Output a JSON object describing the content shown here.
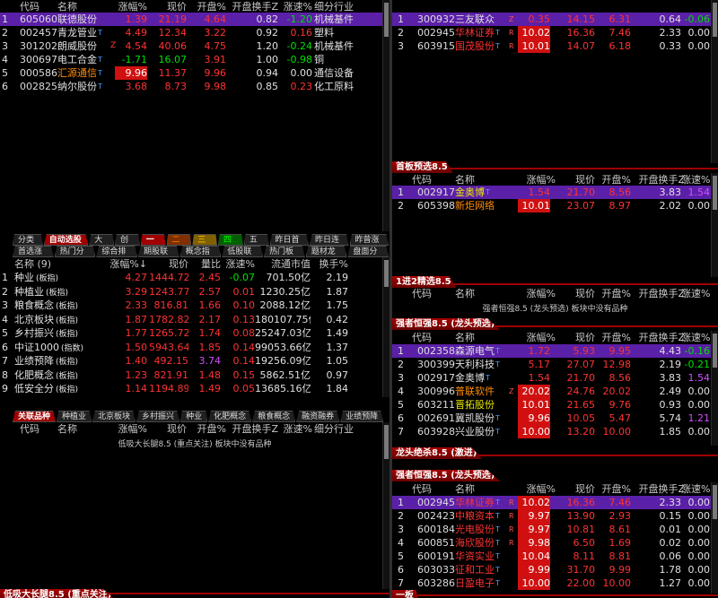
{
  "top_left": {
    "headers": [
      "代码",
      "名称",
      "涨幅%",
      "现价",
      "开盘%",
      "开盘换手Z",
      "涨速%",
      "细分行业"
    ],
    "rows": [
      {
        "idx": "1",
        "code": "605060",
        "name": "联德股份",
        "name_sup": "",
        "mark": "",
        "change": "1.39",
        "price": "21.19",
        "open": "4.64",
        "turnover": "0.82",
        "speed": "-1.20",
        "industry": "机械基件"
      },
      {
        "idx": "2",
        "code": "002457",
        "name": "青龙管业",
        "name_sup": "T",
        "mark": "",
        "change": "4.49",
        "price": "12.34",
        "open": "3.22",
        "turnover": "0.92",
        "speed": "0.16",
        "industry": "塑料"
      },
      {
        "idx": "3",
        "code": "301202",
        "name": "朗威股份",
        "name_sup": "",
        "mark": "Z",
        "change": "4.54",
        "price": "40.06",
        "open": "4.75",
        "turnover": "1.20",
        "speed": "-0.24",
        "industry": "机械基件"
      },
      {
        "idx": "4",
        "code": "300697",
        "name": "电工合金",
        "name_sup": "T",
        "mark": "",
        "change": "-1.71",
        "price": "16.07",
        "open": "3.91",
        "turnover": "1.00",
        "speed": "-0.98",
        "industry": "铜"
      },
      {
        "idx": "5",
        "code": "000586",
        "name": "汇源通信",
        "name_sup": "T",
        "mark": "",
        "change": "9.96",
        "price": "11.37",
        "open": "9.96",
        "turnover": "0.94",
        "speed": "0.00",
        "industry": "通信设备"
      },
      {
        "idx": "6",
        "code": "002825",
        "name": "纳尔股份",
        "name_sup": "T",
        "mark": "",
        "change": "3.68",
        "price": "8.73",
        "open": "9.98",
        "turnover": "0.85",
        "speed": "0.23",
        "industry": "化工原料"
      }
    ]
  },
  "mid_tabs": {
    "row1": [
      "分类▲",
      "自动选股▲",
      "大涨",
      "创业",
      "一板",
      "二板",
      "三板",
      "四板",
      "五板",
      "昨日首板",
      "昨日连板",
      "昨曾涨停"
    ],
    "row2": [
      "首选涨停",
      "热门分布",
      "综合排名",
      "期股联动",
      "概念指数",
      "低股联动",
      "热门板块",
      "题材龙头",
      "盘面分析"
    ]
  },
  "sector": {
    "headers": [
      "名称 (9)",
      "涨幅%↓",
      "现价",
      "量比",
      "涨速%",
      "流通市值",
      "换手%"
    ],
    "rows": [
      {
        "idx": "1",
        "name": "种业",
        "tag": "(板指)",
        "change": "4.27",
        "price": "1444.72",
        "ratio": "2.45",
        "speed": "-0.07",
        "mcap": "701.50亿",
        "turn": "2.19"
      },
      {
        "idx": "2",
        "name": "种植业",
        "tag": "(板指)",
        "change": "3.29",
        "price": "1243.77",
        "ratio": "2.57",
        "speed": "0.01",
        "mcap": "1230.25亿",
        "turn": "1.87"
      },
      {
        "idx": "3",
        "name": "粮食概念",
        "tag": "(板指)",
        "change": "2.33",
        "price": "816.81",
        "ratio": "1.66",
        "speed": "0.10",
        "mcap": "2088.12亿",
        "turn": "1.75"
      },
      {
        "idx": "4",
        "name": "北京板块",
        "tag": "(板指)",
        "change": "1.87",
        "price": "1782.82",
        "ratio": "2.17",
        "speed": "0.13",
        "mcap": "180107.75亿",
        "turn": "0.42"
      },
      {
        "idx": "5",
        "name": "乡村振兴",
        "tag": "(板指)",
        "change": "1.77",
        "price": "1265.72",
        "ratio": "1.74",
        "speed": "0.08",
        "mcap": "25247.03亿",
        "turn": "1.49"
      },
      {
        "idx": "6",
        "name": "中证1000",
        "tag": "(指数)",
        "change": "1.50",
        "price": "5943.64",
        "ratio": "1.85",
        "speed": "0.14",
        "mcap": "99053.66亿",
        "turn": "1.37"
      },
      {
        "idx": "7",
        "name": "业绩预降",
        "tag": "(板指)",
        "change": "1.40",
        "price": "492.15",
        "ratio": "3.74",
        "speed": "0.14",
        "mcap": "19256.09亿",
        "turn": "1.05"
      },
      {
        "idx": "8",
        "name": "化肥概念",
        "tag": "(板指)",
        "change": "1.23",
        "price": "821.91",
        "ratio": "1.48",
        "speed": "0.15",
        "mcap": "5862.51亿",
        "turn": "0.97"
      },
      {
        "idx": "9",
        "name": "低安全分",
        "tag": "(板指)",
        "change": "1.14",
        "price": "1194.89",
        "ratio": "1.49",
        "speed": "0.05",
        "mcap": "13685.16亿",
        "turn": "1.84"
      }
    ]
  },
  "bottom_tabs": [
    "关联品种",
    "种植业",
    "北京板块",
    "乡村振兴",
    "种业",
    "化肥概念",
    "粮食概念",
    "融资融券",
    "业绩预降"
  ],
  "bottom_left": {
    "headers": [
      "代码",
      "名称",
      "涨幅%",
      "现价",
      "开盘%",
      "开盘换手Z",
      "涨速%",
      "细分行业"
    ],
    "empty": "低吸大长腿8.5 (重点关注) 板块中没有品种",
    "title": "低吸大长腿8.5 (重点关注)"
  },
  "right_top": {
    "rows": [
      {
        "idx": "1",
        "code": "300932",
        "name": "三友联众",
        "name_sup": "",
        "mark": "Z",
        "change": "0.35",
        "price": "14.15",
        "open": "6.31",
        "turnover": "0.64",
        "speed": "-0.06"
      },
      {
        "idx": "2",
        "code": "002945",
        "name": "华林证券",
        "name_sup": "T",
        "mark": "R",
        "change": "10.02",
        "price": "16.36",
        "open": "7.46",
        "turnover": "2.33",
        "speed": "0.00"
      },
      {
        "idx": "3",
        "code": "603915",
        "name": "国茂股份",
        "name_sup": "T",
        "mark": "R",
        "change": "10.01",
        "price": "14.07",
        "open": "6.18",
        "turnover": "0.33",
        "speed": "0.00"
      }
    ]
  },
  "first_board": {
    "title": "首板预选8.5",
    "headers": [
      "代码",
      "名称",
      "涨幅%",
      "现价",
      "开盘%",
      "开盘换手Z",
      "涨速%"
    ],
    "rows": [
      {
        "idx": "1",
        "code": "002917",
        "name": "金奥博",
        "name_sup": "T",
        "mark": "",
        "change": "1.54",
        "price": "21.70",
        "open": "8.56",
        "turnover": "3.83",
        "speed": "1.54"
      },
      {
        "idx": "2",
        "code": "605398",
        "name": "新炬网络",
        "name_sup": "",
        "mark": "",
        "change": "10.01",
        "price": "23.07",
        "open": "8.97",
        "turnover": "2.02",
        "speed": "0.00"
      }
    ]
  },
  "one_to_two": {
    "title": "1进2精选8.5",
    "headers": [
      "代码",
      "名称",
      "涨幅%",
      "现价",
      "开盘%",
      "开盘换手Z",
      "涨速%"
    ],
    "empty": "强者恒强8.5 (龙头预选) 板块中没有品种"
  },
  "strong": {
    "title": "强者恒强8.5 (龙头预选)",
    "headers": [
      "代码",
      "名称",
      "涨幅%",
      "现价",
      "开盘%",
      "开盘换手Z",
      "涨速%"
    ],
    "rows": [
      {
        "idx": "1",
        "code": "002358",
        "name": "森源电气",
        "name_sup": "T",
        "mark": "",
        "change": "1.72",
        "price": "5.93",
        "open": "9.95",
        "turnover": "4.43",
        "speed": "-0.16"
      },
      {
        "idx": "2",
        "code": "300399",
        "name": "天利科技",
        "name_sup": "T",
        "mark": "",
        "change": "5.17",
        "price": "27.07",
        "open": "12.98",
        "turnover": "2.19",
        "speed": "-0.21"
      },
      {
        "idx": "3",
        "code": "002917",
        "name": "金奥博",
        "name_sup": "T",
        "mark": "",
        "change": "1.54",
        "price": "21.70",
        "open": "8.56",
        "turnover": "3.83",
        "speed": "1.54"
      },
      {
        "idx": "4",
        "code": "300996",
        "name": "普联软件",
        "name_sup": "",
        "mark": "Z",
        "change": "20.02",
        "price": "24.76",
        "open": "20.02",
        "turnover": "2.49",
        "speed": "0.00"
      },
      {
        "idx": "5",
        "code": "603211",
        "name": "晋拓股份",
        "name_sup": "",
        "mark": "",
        "change": "10.01",
        "price": "21.65",
        "open": "9.76",
        "turnover": "0.93",
        "speed": "0.00"
      },
      {
        "idx": "6",
        "code": "002691",
        "name": "冀凯股份",
        "name_sup": "T",
        "mark": "",
        "change": "9.96",
        "price": "10.05",
        "open": "5.47",
        "turnover": "5.74",
        "speed": "1.21"
      },
      {
        "idx": "7",
        "code": "603928",
        "name": "兴业股份",
        "name_sup": "T",
        "mark": "",
        "change": "10.00",
        "price": "13.20",
        "open": "10.00",
        "turnover": "1.85",
        "speed": "0.00"
      }
    ]
  },
  "dragon": {
    "title": "龙头绝杀8.5 (激进)",
    "title2": "强者恒强8.5 (龙头预选)",
    "headers": [
      "代码",
      "名称",
      "涨幅%",
      "现价",
      "开盘%",
      "开盘换手Z",
      "涨速%"
    ],
    "rows": [
      {
        "idx": "1",
        "code": "002945",
        "name": "华林证券",
        "name_sup": "T",
        "mark": "R",
        "change": "10.02",
        "price": "16.36",
        "open": "7.46",
        "turnover": "2.33",
        "speed": "0.00"
      },
      {
        "idx": "2",
        "code": "002423",
        "name": "中粮资本",
        "name_sup": "T",
        "mark": "R",
        "change": "9.97",
        "price": "13.90",
        "open": "2.93",
        "turnover": "0.15",
        "speed": "0.00"
      },
      {
        "idx": "3",
        "code": "600184",
        "name": "光电股份",
        "name_sup": "T",
        "mark": "R",
        "change": "9.97",
        "price": "10.81",
        "open": "8.61",
        "turnover": "0.01",
        "speed": "0.00"
      },
      {
        "idx": "4",
        "code": "600851",
        "name": "海欣股份",
        "name_sup": "T",
        "mark": "R",
        "change": "9.98",
        "price": "6.50",
        "open": "1.69",
        "turnover": "0.02",
        "speed": "0.00"
      },
      {
        "idx": "5",
        "code": "600191",
        "name": "华资实业",
        "name_sup": "T",
        "mark": "",
        "change": "10.04",
        "price": "8.11",
        "open": "8.81",
        "turnover": "0.06",
        "speed": "0.00"
      },
      {
        "idx": "6",
        "code": "603033",
        "name": "征和工业",
        "name_sup": "T",
        "mark": "",
        "change": "9.99",
        "price": "31.70",
        "open": "9.99",
        "turnover": "1.78",
        "speed": "0.00"
      },
      {
        "idx": "7",
        "code": "603286",
        "name": "日盈电子",
        "name_sup": "T",
        "mark": "",
        "change": "10.00",
        "price": "22.00",
        "open": "10.00",
        "turnover": "1.27",
        "speed": "0.00"
      }
    ],
    "footer": "一板"
  },
  "colors": {
    "selected_row": "#5b20a8",
    "title_red": "#a80000",
    "limit_up_cell": "#d01010",
    "up": "#ff3232",
    "down": "#00e000"
  }
}
